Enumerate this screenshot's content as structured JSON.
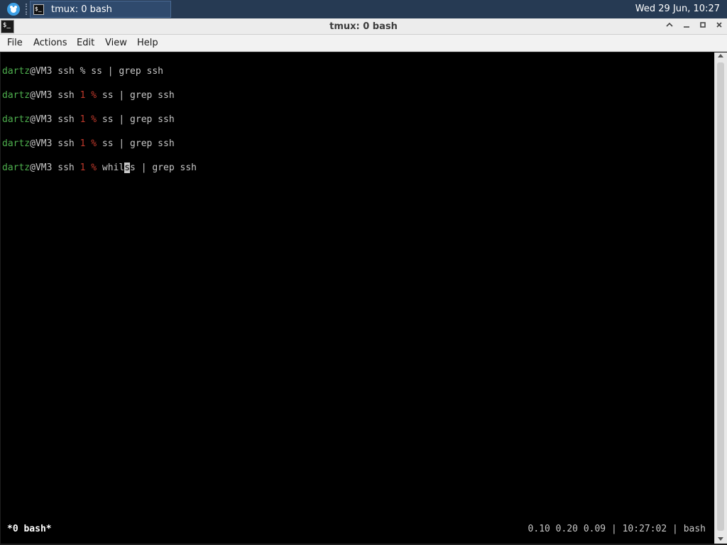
{
  "panel": {
    "launcher_icon": "xfce-mouse-icon",
    "task_label": "tmux: 0 bash",
    "task_icon_text": "$_",
    "clock": "Wed 29 Jun, 10:27"
  },
  "window": {
    "title": "tmux: 0 bash",
    "icon_text": "$_",
    "controls": {
      "shade": "^",
      "minimize": "–",
      "maximize": "□",
      "close": "×"
    }
  },
  "menu": {
    "file": "File",
    "actions": "Actions",
    "edit": "Edit",
    "view": "View",
    "help": "Help"
  },
  "terminal": {
    "lines": [
      {
        "user": "dartz",
        "host": "@VM3 ssh ",
        "code": "",
        "prompt": "% ",
        "cmd_before": "ss | grep ssh",
        "cursor": "",
        "cmd_after": ""
      },
      {
        "user": "dartz",
        "host": "@VM3 ssh ",
        "code": "1 %",
        "prompt": " ",
        "cmd_before": "ss | grep ssh",
        "cursor": "",
        "cmd_after": ""
      },
      {
        "user": "dartz",
        "host": "@VM3 ssh ",
        "code": "1 %",
        "prompt": " ",
        "cmd_before": "ss | grep ssh",
        "cursor": "",
        "cmd_after": ""
      },
      {
        "user": "dartz",
        "host": "@VM3 ssh ",
        "code": "1 %",
        "prompt": " ",
        "cmd_before": "ss | grep ssh",
        "cursor": "",
        "cmd_after": ""
      },
      {
        "user": "dartz",
        "host": "@VM3 ssh ",
        "code": "1 %",
        "prompt": " ",
        "cmd_before": "whil",
        "cursor": "s",
        "cmd_after": "s | grep ssh"
      }
    ],
    "status_left": "*0 bash*",
    "status_right": "0.10 0.20 0.09 | 10:27:02 | bash"
  },
  "colors": {
    "panel_bg": "#263a53",
    "terminal_bg": "#000000",
    "prompt_user": "#4eb04e",
    "exit_code": "#c0392b",
    "terminal_fg": "#c7c7c7"
  }
}
